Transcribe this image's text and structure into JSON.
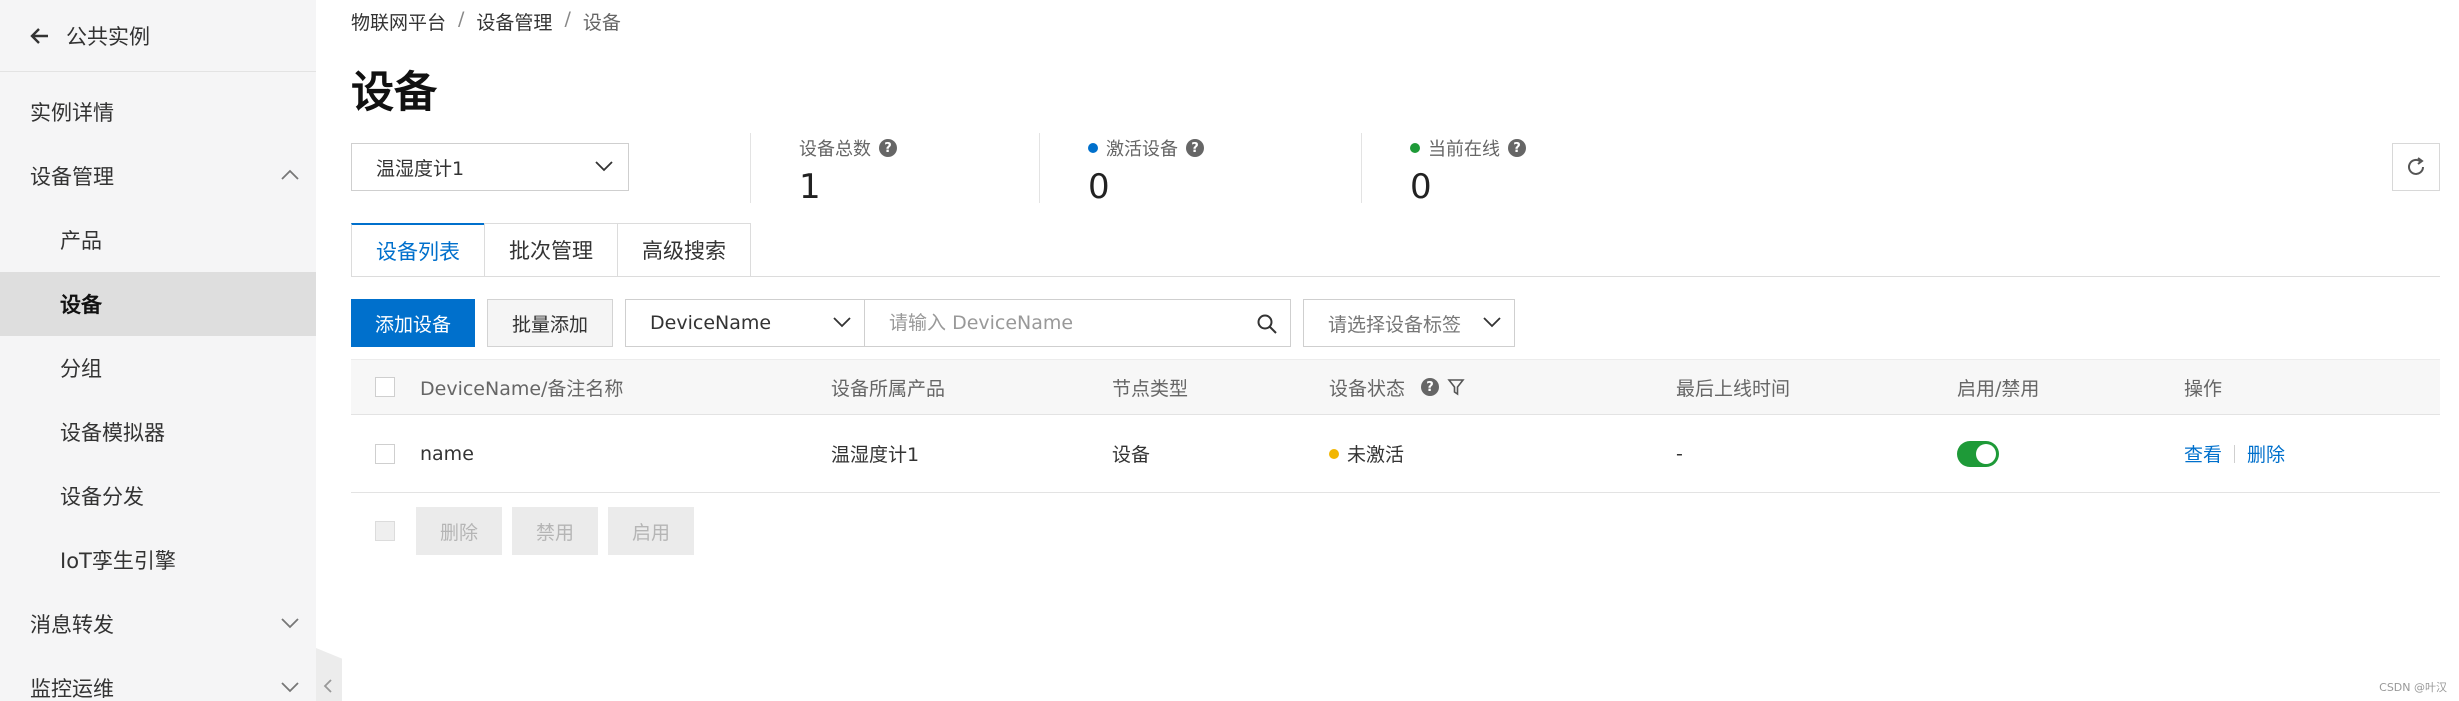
{
  "sidebar": {
    "back_label": "公共实例",
    "items": [
      {
        "label": "实例详情"
      },
      {
        "label": "设备管理"
      },
      {
        "label": "产品"
      },
      {
        "label": "设备"
      },
      {
        "label": "分组"
      },
      {
        "label": "设备模拟器"
      },
      {
        "label": "设备分发"
      },
      {
        "label": "IoT孪生引擎"
      },
      {
        "label": "消息转发"
      },
      {
        "label": "监控运维"
      }
    ]
  },
  "breadcrumb": [
    "物联网平台",
    "设备管理",
    "设备"
  ],
  "breadcrumb_sep": "/",
  "page_title": "设备",
  "product_select": {
    "value": "温湿度计1"
  },
  "stats": {
    "total": {
      "label": "设备总数",
      "value": "1"
    },
    "activated": {
      "label": "激活设备",
      "value": "0",
      "dot_color": "#0070cc"
    },
    "online": {
      "label": "当前在线",
      "value": "0",
      "dot_color": "#1e9a38"
    }
  },
  "help_glyph": "?",
  "tabs": [
    {
      "label": "设备列表",
      "active": true
    },
    {
      "label": "批次管理"
    },
    {
      "label": "高级搜索"
    }
  ],
  "toolbar": {
    "add_label": "添加设备",
    "batch_add_label": "批量添加",
    "search_type": "DeviceName",
    "search_placeholder": "请输入 DeviceName",
    "tag_placeholder": "请选择设备标签"
  },
  "table": {
    "headers": [
      "DeviceName/备注名称",
      "设备所属产品",
      "节点类型",
      "设备状态",
      "最后上线时间",
      "启用/禁用",
      "操作"
    ],
    "rows": [
      {
        "name": "name",
        "product": "温湿度计1",
        "node_type": "设备",
        "status": "未激活",
        "status_color": "#f2b600",
        "last_online": "-",
        "enabled": true,
        "actions": [
          "查看",
          "删除"
        ]
      }
    ]
  },
  "bulk_actions": [
    "删除",
    "禁用",
    "启用"
  ],
  "watermark": "CSDN @叶汉",
  "colors": {
    "primary": "#0070cc",
    "success": "#1e9a38",
    "warning": "#f2b600"
  }
}
